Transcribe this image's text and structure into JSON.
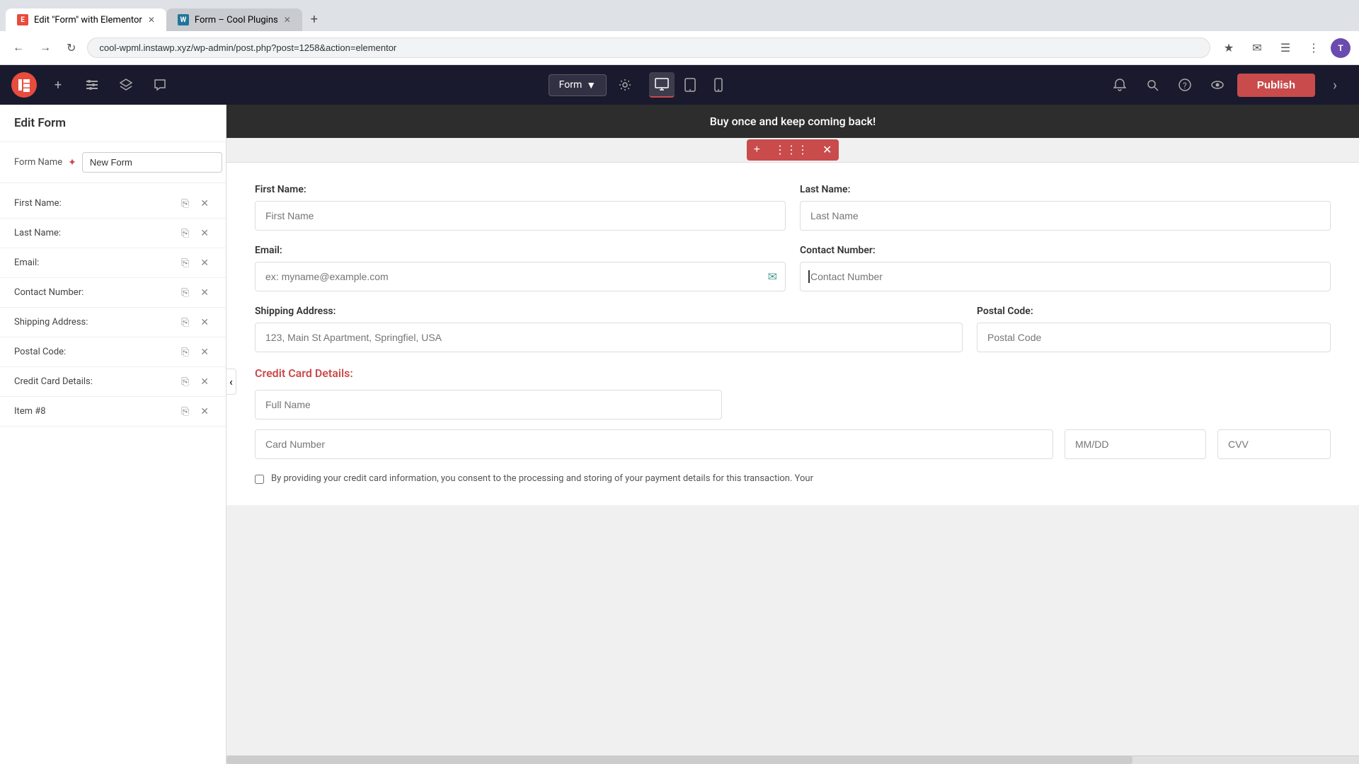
{
  "browser": {
    "tabs": [
      {
        "id": "tab1",
        "title": "Edit \"Form\" with Elementor",
        "active": true,
        "favicon": "E"
      },
      {
        "id": "tab2",
        "title": "Form – Cool Plugins",
        "active": false,
        "favicon": "W"
      }
    ],
    "url": "cool-wpml.instawp.xyz/wp-admin/post.php?post=1258&action=elementor"
  },
  "topbar": {
    "logo": "E",
    "form_selector": "Form",
    "publish_label": "Publish"
  },
  "left_panel": {
    "title": "Edit Form",
    "form_name_label": "Form Name",
    "form_name_value": "New Form",
    "fields": [
      {
        "label": "First Name:"
      },
      {
        "label": "Last Name:"
      },
      {
        "label": "Email:"
      },
      {
        "label": "Contact Number:"
      },
      {
        "label": "Shipping Address:"
      },
      {
        "label": "Postal Code:"
      },
      {
        "label": "Credit Card Details:"
      },
      {
        "label": "Item #8"
      }
    ]
  },
  "canvas": {
    "promo_text": "Buy once and keep coming back!",
    "form": {
      "first_name_label": "First Name:",
      "first_name_placeholder": "First Name",
      "last_name_label": "Last Name:",
      "last_name_placeholder": "Last Name",
      "email_label": "Email:",
      "email_placeholder": "ex: myname@example.com",
      "contact_label": "Contact Number:",
      "contact_placeholder": "Contact Number",
      "shipping_label": "Shipping Address:",
      "shipping_placeholder": "123, Main St Apartment, Springfiel, USA",
      "postal_label": "Postal Code:",
      "postal_placeholder": "Postal Code",
      "credit_card_label": "Credit Card Details:",
      "full_name_placeholder": "Full Name",
      "card_number_placeholder": "Card Number",
      "expiry_placeholder": "MM/DD",
      "cvv_placeholder": "CVV",
      "consent_text": "By providing your credit card information, you consent to the processing and storing of your payment details for this transaction. Your"
    }
  }
}
